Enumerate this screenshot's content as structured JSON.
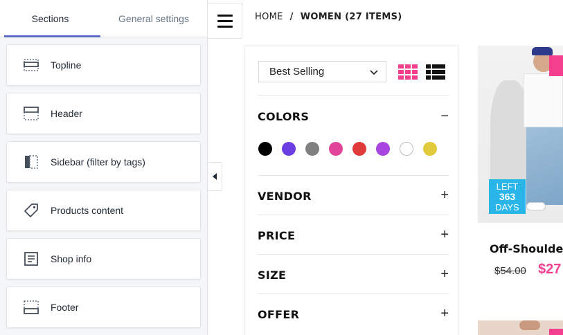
{
  "editor": {
    "tabs": [
      {
        "label": "Sections",
        "active": true
      },
      {
        "label": "General settings",
        "active": false
      }
    ],
    "sections": [
      {
        "label": "Topline",
        "icon": "topline-icon"
      },
      {
        "label": "Header",
        "icon": "header-icon"
      },
      {
        "label": "Sidebar (filter by tags)",
        "icon": "sidebar-icon"
      },
      {
        "label": "Products content",
        "icon": "tag-icon"
      },
      {
        "label": "Shop info",
        "icon": "document-icon"
      },
      {
        "label": "Footer",
        "icon": "footer-icon"
      }
    ]
  },
  "store": {
    "breadcrumb": {
      "home": "HOME",
      "separator": "/",
      "current": "WOMEN (27 ITEMS)"
    },
    "sort": {
      "selected": "Best Selling"
    },
    "filters": {
      "colors_title": "COLORS",
      "colors_toggle": "−",
      "swatches": [
        "#000000",
        "#6a3ee0",
        "#808080",
        "#e0459a",
        "#e03a3a",
        "#a845e0",
        "#ffffff",
        "#e0c93a"
      ],
      "groups": [
        {
          "title": "VENDOR",
          "toggle": "+"
        },
        {
          "title": "PRICE",
          "toggle": "+"
        },
        {
          "title": "SIZE",
          "toggle": "+"
        },
        {
          "title": "OFFER",
          "toggle": "+"
        }
      ]
    },
    "product": {
      "badge_left": "LEFT",
      "badge_days_count": "363",
      "badge_days": "DAYS",
      "title": "Off-Shoulde",
      "old_price": "$54.00",
      "new_price": "$27"
    },
    "accent_color": "#f43f8e",
    "badge_color": "#29b5e8"
  }
}
